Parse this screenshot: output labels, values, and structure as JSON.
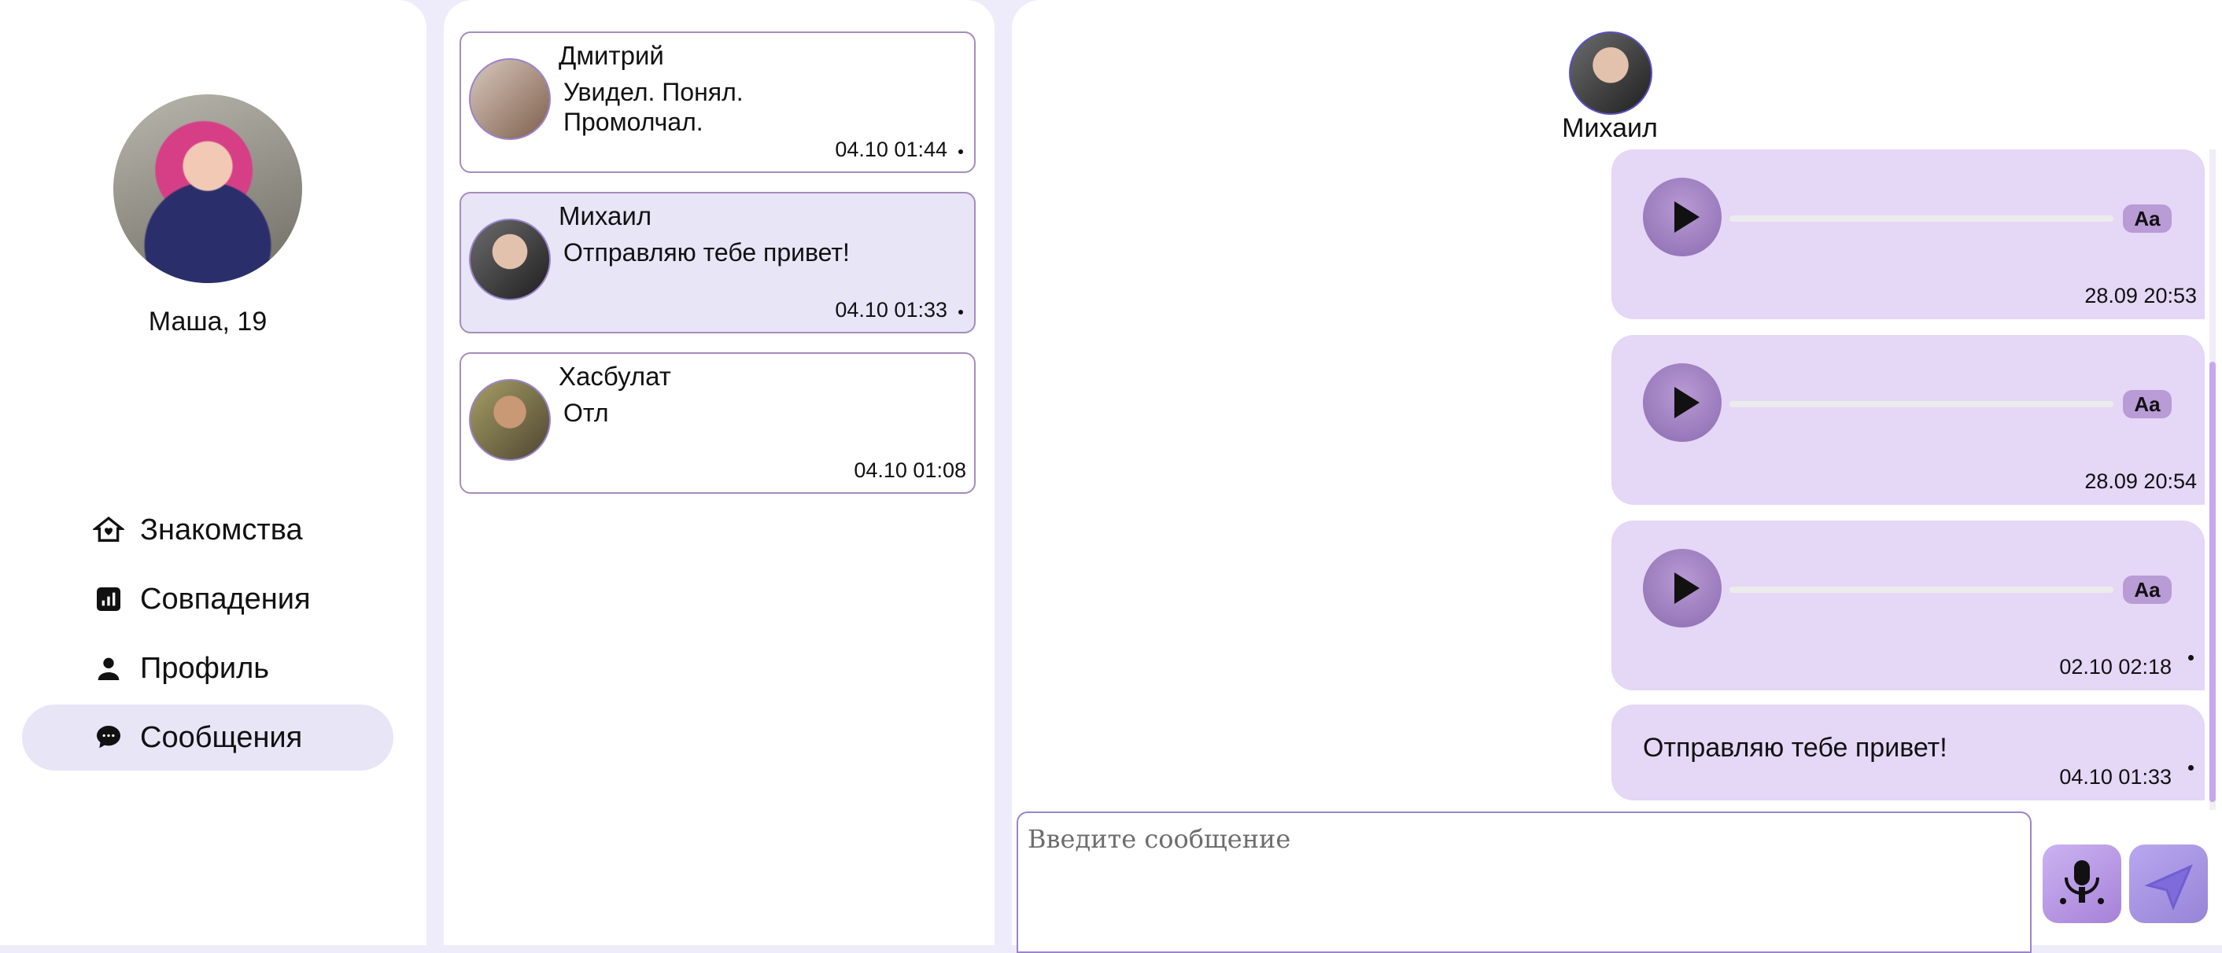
{
  "user": {
    "name": "Маша, 19"
  },
  "nav": [
    {
      "label": "Знакомства",
      "icon": "home-heart-icon"
    },
    {
      "label": "Совпадения",
      "icon": "chart-icon"
    },
    {
      "label": "Профиль",
      "icon": "person-icon"
    },
    {
      "label": "Сообщения",
      "icon": "chat-icon",
      "active": true
    }
  ],
  "dialogs": [
    {
      "name": "Дмитрий",
      "text": "Увидел. Понял.\nПромолчал.",
      "time": "04.10 01:44"
    },
    {
      "name": "Михаил",
      "text": "Отправляю тебе привет!",
      "time": "04.10 01:33"
    },
    {
      "name": "Хасбулат",
      "text": "Отл",
      "time": "04.10 01:08"
    }
  ],
  "chat": {
    "peer_name": "Михаил",
    "messages": [
      {
        "kind": "voice",
        "time": "28.09 20:53",
        "aa": "Aa"
      },
      {
        "kind": "voice",
        "time": "28.09 20:54",
        "aa": "Aa"
      },
      {
        "kind": "voice",
        "time": "02.10 02:18",
        "aa": "Aa"
      },
      {
        "kind": "text",
        "text": "Отправляю тебе привет!",
        "time": "04.10 01:33"
      }
    ],
    "composer_placeholder": "Введите  сообщение"
  },
  "colors": {
    "background": "#eeecfb",
    "accent": "#a78bbd",
    "bubble": "#e5d7f6",
    "selected": "#e8e5f7"
  }
}
